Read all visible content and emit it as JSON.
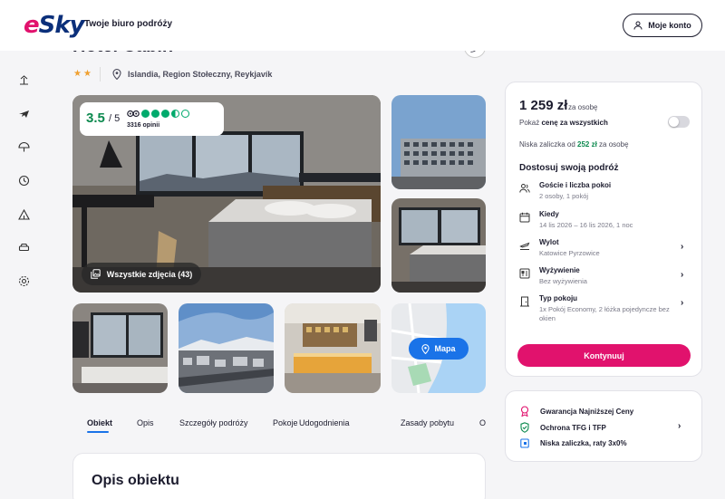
{
  "header": {
    "logo": "eSky",
    "tagline": "Twoje biuro podróży",
    "account_label": "Moje konto"
  },
  "rail": {
    "icons": [
      "beach-icon",
      "plane-icon",
      "umbrella-icon",
      "clock-icon",
      "camping-icon",
      "car-icon",
      "settings-icon"
    ]
  },
  "hotel": {
    "name": "Hotel Cabin",
    "stars": 2,
    "stars_text": "★★",
    "location": "Islandia, Region Stołeczny, Reykjavík"
  },
  "rating": {
    "score": "3.5",
    "max": "/ 5",
    "reviews": "3316 opinii",
    "bubbles": 3.5
  },
  "gallery": {
    "all_photos_label": "Wszystkie zdjęcia (43)",
    "map_label": "Mapa"
  },
  "tabs": [
    {
      "label": "Obiekt",
      "active": true
    },
    {
      "label": "Opis",
      "active": false
    },
    {
      "label": "Szczegóły podróży",
      "active": false
    },
    {
      "label": "Pokoje",
      "active": false
    },
    {
      "label": "Udogodnienia",
      "active": false
    },
    {
      "label": "Zasady pobytu",
      "active": false
    },
    {
      "label": "Op",
      "active": false
    }
  ],
  "description": {
    "title": "Opis obiektu"
  },
  "pricing": {
    "price": "1 259 zł",
    "per_person": "za osobę",
    "show_total_prefix": "Pokaż ",
    "show_total_bold": "cenę za wszystkich",
    "toggle_on": false,
    "deposit_prefix": "Niska zaliczka od ",
    "deposit_amount": "252 zł",
    "deposit_suffix": " za osobę",
    "adjust_title": "Dostosuj swoją podróż",
    "options": [
      {
        "icon": "guests-icon",
        "label": "Goście i liczba pokoi",
        "value": "2 osoby, 1 pokój",
        "chevron": false
      },
      {
        "icon": "calendar-icon",
        "label": "Kiedy",
        "value": "14 lis 2026 – 16 lis 2026, 1 noc",
        "chevron": false
      },
      {
        "icon": "departure-icon",
        "label": "Wylot",
        "value": "Katowice Pyrzowice",
        "chevron": true
      },
      {
        "icon": "meal-icon",
        "label": "Wyżywienie",
        "value": "Bez wyżywienia",
        "chevron": true
      },
      {
        "icon": "door-icon",
        "label": "Typ pokoju",
        "value": "1x Pokój Economy, 2 łóżka pojedyncze bez okien",
        "chevron": true
      }
    ],
    "continue_label": "Kontynuuj"
  },
  "guarantees": [
    {
      "icon": "badge-icon",
      "label": "Gwarancja Najniższej Ceny"
    },
    {
      "icon": "shield-check-icon",
      "label": "Ochrona TFG i TFP"
    },
    {
      "icon": "wallet-icon",
      "label": "Niska zaliczka, raty 3x0%"
    }
  ],
  "colors": {
    "brand_pink": "#e1126d",
    "brand_navy": "#0b2f7a",
    "link_blue": "#1a73e8",
    "success_green": "#0d8a4f",
    "tripadvisor_green": "#00aa6c"
  }
}
